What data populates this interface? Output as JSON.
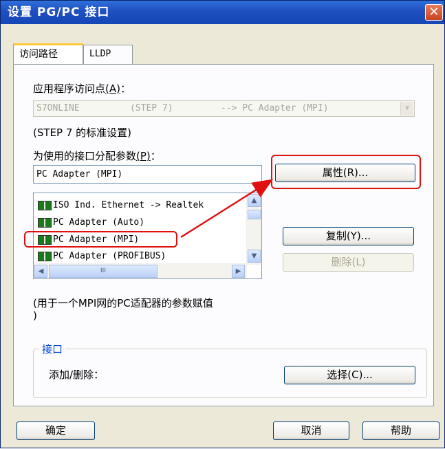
{
  "window": {
    "title": "设置 PG/PC 接口",
    "close_glyph": "✕"
  },
  "tabs": [
    {
      "label": "访问路径"
    },
    {
      "label": "LLDP"
    }
  ],
  "access_point": {
    "label": "应用程序访问点",
    "mnemonic": "(A)",
    "colon": "：",
    "value_name": "S7ONLINE",
    "value_step": "(STEP 7)",
    "value_target": "--> PC Adapter (MPI)",
    "note": "(STEP 7 的标准设置)"
  },
  "interface_params": {
    "label": "为使用的接口分配参数",
    "mnemonic": "(P)",
    "colon": "：",
    "current_value": "PC Adapter (MPI)"
  },
  "interface_list": {
    "items": [
      {
        "label": "ISO Ind. Ethernet -> Realtek"
      },
      {
        "label": "PC Adapter (Auto)"
      },
      {
        "label": "PC Adapter (MPI)"
      },
      {
        "label": "PC Adapter (PROFIBUS)"
      }
    ],
    "scroll_grip": "III"
  },
  "buttons": {
    "properties": "属性(R)...",
    "copy": "复制(Y)...",
    "delete": "删除(L)",
    "select": "选择(C)...",
    "ok": "确定",
    "cancel": "取消",
    "help": "帮助"
  },
  "description": "(用于一个MPI网的PC适配器的参数赋值\n)",
  "interface_group": {
    "title": "接口",
    "add_remove_label": "添加/删除："
  },
  "colors": {
    "annotation": "#e01010",
    "title_bar": "#1f4fc0"
  }
}
